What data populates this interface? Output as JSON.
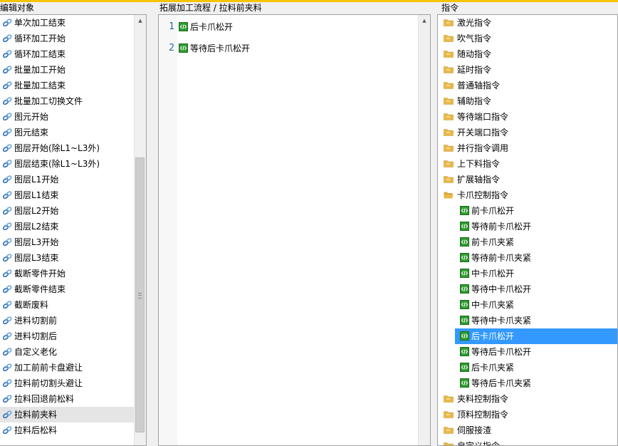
{
  "left_panel": {
    "title": "编辑对象",
    "items": [
      "单次加工结束",
      "循环加工开始",
      "循环加工结束",
      "批量加工开始",
      "批量加工结束",
      "批量加工切换文件",
      "图元开始",
      "图元结束",
      "图层开始(除L1~L3外)",
      "图层结束(除L1~L3外)",
      "图层L1开始",
      "图层L1结束",
      "图层L2开始",
      "图层L2结束",
      "图层L3开始",
      "图层L3结束",
      "截断零件开始",
      "截断零件结束",
      "截断废料",
      "进料切割前",
      "进料切割后",
      "自定义老化",
      "加工前前卡盘避让",
      "拉料前切割头避让",
      "拉料回退前松料",
      "拉料前夹料",
      "拉料后松料"
    ],
    "selected_index": 25
  },
  "middle_panel": {
    "title": "拓展加工流程 / 拉料前夹料",
    "lines": [
      {
        "num": "1",
        "text": "后卡爪松开"
      },
      {
        "num": "2",
        "text": "等待后卡爪松开"
      }
    ]
  },
  "right_panel": {
    "title": "指令",
    "categories_top": [
      "激光指令",
      "吹气指令",
      "随动指令",
      "延时指令",
      "普通轴指令",
      "辅助指令",
      "等待端口指令",
      "开关端口指令",
      "并行指令调用",
      "上下料指令",
      "扩展轴指令"
    ],
    "expanded_category": "卡爪控制指令",
    "expanded_children": [
      "前卡爪松开",
      "等待前卡爪松开",
      "前卡爪夹紧",
      "等待前卡爪夹紧",
      "中卡爪松开",
      "等待中卡爪松开",
      "中卡爪夹紧",
      "等待中卡爪夹紧",
      "后卡爪松开",
      "等待后卡爪松开",
      "后卡爪夹紧",
      "等待后卡爪夹紧"
    ],
    "selected_child_index": 8,
    "categories_bottom": [
      "夹料控制指令",
      "顶料控制指令",
      "伺服接渣",
      "自定义指令"
    ]
  },
  "colors": {
    "selection_blue": "#3399ff",
    "folder": "#e8b84a",
    "command_icon": "#2e9a2e",
    "link_icon": "#2f6fb5",
    "line_number": "#2b6aa0"
  }
}
